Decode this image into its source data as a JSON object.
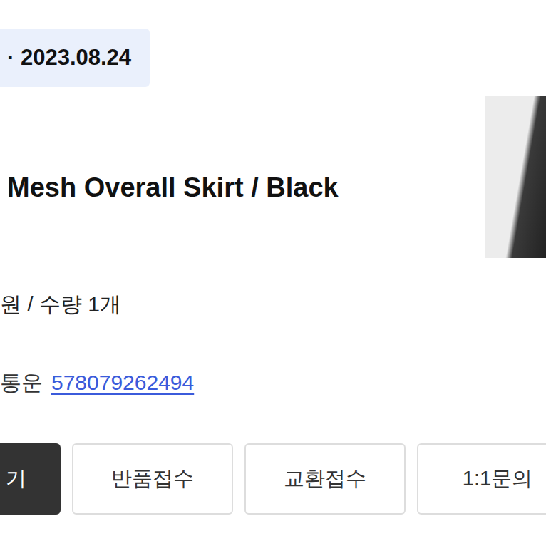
{
  "order": {
    "status_badge": "· 2023.08.24"
  },
  "product": {
    "name": "Mesh Overall Skirt / Black",
    "price_quantity": "원 / 수량 1개",
    "courier": "통운",
    "tracking_number": "578079262494"
  },
  "buttons": [
    {
      "label": "기",
      "kind": "primary"
    },
    {
      "label": "반품접수",
      "kind": "outline"
    },
    {
      "label": "교환접수",
      "kind": "outline"
    },
    {
      "label": "1:1문의",
      "kind": "outline"
    }
  ]
}
